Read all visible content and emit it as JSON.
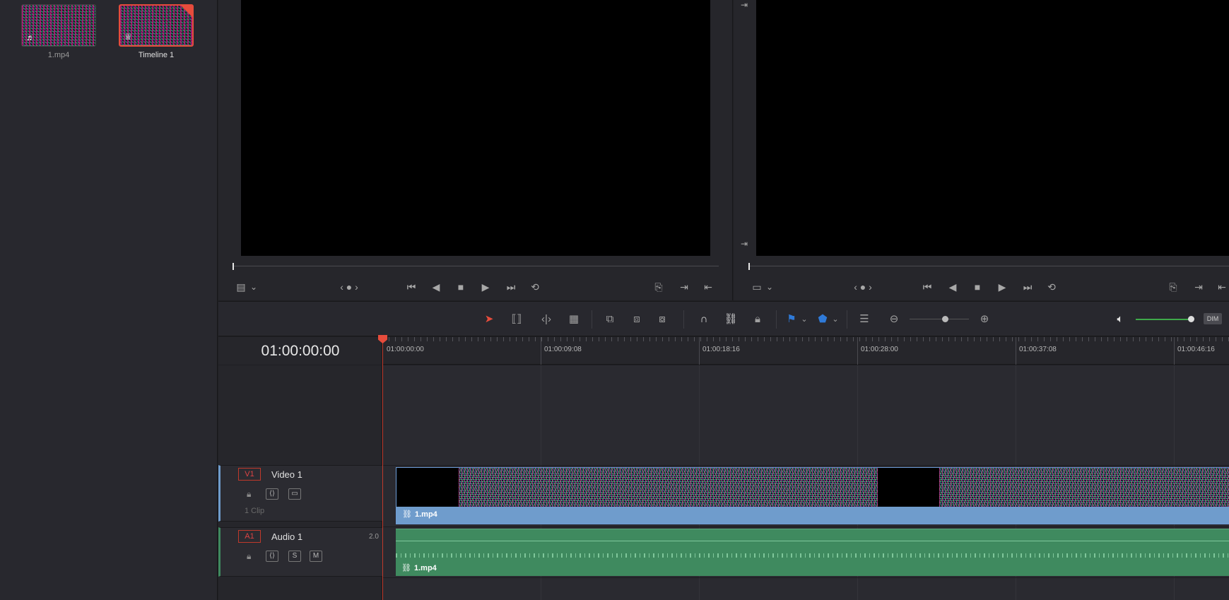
{
  "media_pool": {
    "items": [
      {
        "label": "1.mp4",
        "glyph": "♬"
      },
      {
        "label": "Timeline 1",
        "glyph": "♕"
      }
    ]
  },
  "viewer": {
    "left_jog": "‹ ● ›",
    "right_jog": "‹ ● ›"
  },
  "timeline": {
    "timecode": "01:00:00:00",
    "ruler_labels": [
      "01:00:00:00",
      "01:00:09:08",
      "01:00:18:16",
      "01:00:28:00",
      "01:00:37:08",
      "01:00:46:16"
    ]
  },
  "tracks": {
    "video": {
      "badge": "V1",
      "name": "Video 1",
      "clip_count": "1 Clip",
      "clip_name": "1.mp4"
    },
    "audio": {
      "badge": "A1",
      "name": "Audio 1",
      "channels": "2.0",
      "clip_name": "1.mp4",
      "solo": "S",
      "mute": "M"
    }
  },
  "toolbar": {
    "dim_label": "DIM"
  },
  "colors": {
    "playhead": "#e74c3c",
    "video_clip": "#6f9ccc",
    "audio_clip": "#3f8a5f",
    "volume": "#3fa94a",
    "flag_blue": "#2f7ad8"
  },
  "icons": [
    "music-note-icon",
    "timeline-icon",
    "view-mode-icon",
    "chevron-down-icon",
    "jump-to-start-icon",
    "play-reverse-icon",
    "stop-icon",
    "play-icon",
    "jump-to-end-icon",
    "loop-icon",
    "match-frame-icon",
    "next-edit-icon",
    "prev-edit-icon",
    "selection-arrow-icon",
    "trim-edit-icon",
    "dynamic-trim-icon",
    "blade-icon",
    "insert-clip-icon",
    "overwrite-clip-icon",
    "replace-clip-icon",
    "snapping-icon",
    "linked-selection-icon",
    "position-lock-icon",
    "flag-icon",
    "marker-icon",
    "timeline-view-icon",
    "zoom-out-icon",
    "zoom-in-icon",
    "speaker-icon",
    "lock-icon",
    "auto-select-icon",
    "monitor-icon",
    "link-icon"
  ]
}
